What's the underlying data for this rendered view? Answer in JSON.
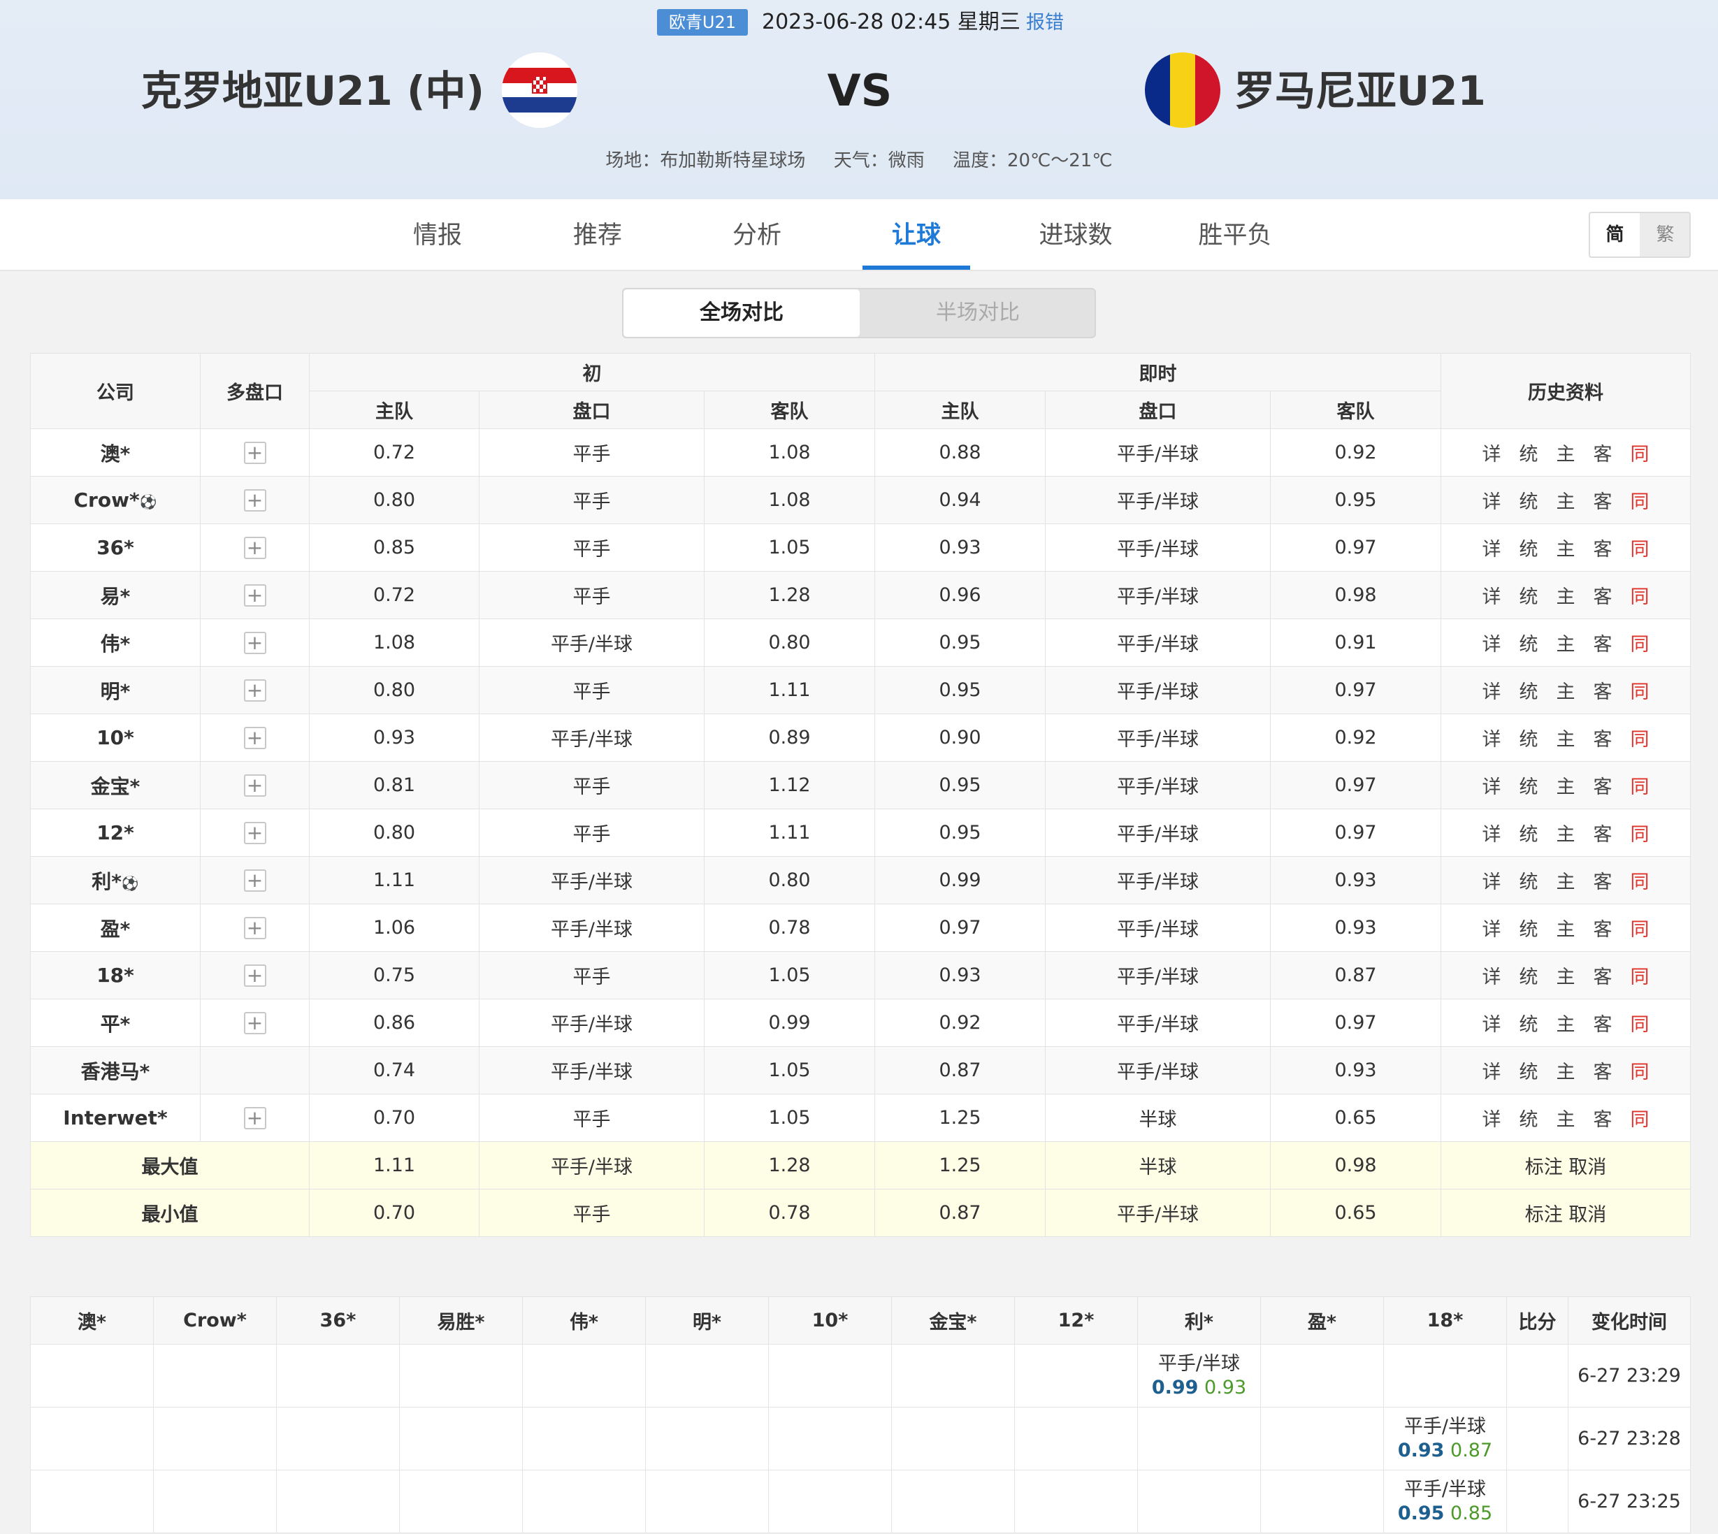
{
  "header": {
    "league": "欧青U21",
    "datetime": "2023-06-28 02:45 星期三",
    "report_label": "报错",
    "home_team": "克罗地亚U21 (中)",
    "away_team": "罗马尼亚U21",
    "vs": "VS",
    "venue": "场地：布加勒斯特星球场",
    "weather": "天气：微雨",
    "temperature": "温度：20℃～21℃",
    "home_flag": "croatia-flag-icon",
    "away_flag": "romania-flag-icon"
  },
  "tabs": [
    "情报",
    "推荐",
    "分析",
    "让球",
    "进球数",
    "胜平负"
  ],
  "active_tab": "让球",
  "lang": {
    "simple": "简",
    "trad": "繁"
  },
  "segment": {
    "full": "全场对比",
    "half": "半场对比"
  },
  "table": {
    "headers": {
      "company": "公司",
      "multi": "多盘口",
      "initial": "初",
      "live": "即时",
      "home": "主队",
      "line": "盘口",
      "away": "客队",
      "history": "历史资料"
    },
    "history_links": [
      "详",
      "统",
      "主",
      "客",
      "同"
    ],
    "rows": [
      {
        "company": "澳*",
        "ball": "",
        "plus": true,
        "i_home": "0.72",
        "i_line": "平手",
        "i_away": "1.08",
        "l_home": "0.88",
        "l_line": "平手/半球",
        "l_away": "0.92"
      },
      {
        "company": "Crow*",
        "ball": "⚽",
        "plus": true,
        "i_home": "0.80",
        "i_line": "平手",
        "i_away": "1.08",
        "l_home": "0.94",
        "l_line": "平手/半球",
        "l_away": "0.95"
      },
      {
        "company": "36*",
        "ball": "",
        "plus": true,
        "i_home": "0.85",
        "i_line": "平手",
        "i_away": "1.05",
        "l_home": "0.93",
        "l_line": "平手/半球",
        "l_away": "0.97"
      },
      {
        "company": "易*",
        "ball": "",
        "plus": true,
        "i_home": "0.72",
        "i_line": "平手",
        "i_away": "1.28",
        "l_home": "0.96",
        "l_line": "平手/半球",
        "l_away": "0.98"
      },
      {
        "company": "伟*",
        "ball": "",
        "plus": true,
        "i_home": "1.08",
        "i_line": "平手/半球",
        "i_away": "0.80",
        "l_home": "0.95",
        "l_line": "平手/半球",
        "l_away": "0.91"
      },
      {
        "company": "明*",
        "ball": "",
        "plus": true,
        "i_home": "0.80",
        "i_line": "平手",
        "i_away": "1.11",
        "l_home": "0.95",
        "l_line": "平手/半球",
        "l_away": "0.97"
      },
      {
        "company": "10*",
        "ball": "",
        "plus": true,
        "i_home": "0.93",
        "i_line": "平手/半球",
        "i_away": "0.89",
        "l_home": "0.90",
        "l_line": "平手/半球",
        "l_away": "0.92"
      },
      {
        "company": "金宝*",
        "ball": "",
        "plus": true,
        "i_home": "0.81",
        "i_line": "平手",
        "i_away": "1.12",
        "l_home": "0.95",
        "l_line": "平手/半球",
        "l_away": "0.97"
      },
      {
        "company": "12*",
        "ball": "",
        "plus": true,
        "i_home": "0.80",
        "i_line": "平手",
        "i_away": "1.11",
        "l_home": "0.95",
        "l_line": "平手/半球",
        "l_away": "0.97"
      },
      {
        "company": "利*",
        "ball": "⚽",
        "plus": true,
        "i_home": "1.11",
        "i_line": "平手/半球",
        "i_away": "0.80",
        "l_home": "0.99",
        "l_line": "平手/半球",
        "l_away": "0.93"
      },
      {
        "company": "盈*",
        "ball": "",
        "plus": true,
        "i_home": "1.06",
        "i_line": "平手/半球",
        "i_away": "0.78",
        "l_home": "0.97",
        "l_line": "平手/半球",
        "l_away": "0.93"
      },
      {
        "company": "18*",
        "ball": "",
        "plus": true,
        "i_home": "0.75",
        "i_line": "平手",
        "i_away": "1.05",
        "l_home": "0.93",
        "l_line": "平手/半球",
        "l_away": "0.87"
      },
      {
        "company": "平*",
        "ball": "",
        "plus": true,
        "i_home": "0.86",
        "i_line": "平手/半球",
        "i_away": "0.99",
        "l_home": "0.92",
        "l_line": "平手/半球",
        "l_away": "0.97"
      },
      {
        "company": "香港马*",
        "ball": "",
        "plus": false,
        "i_home": "0.74",
        "i_line": "平手/半球",
        "i_away": "1.05",
        "l_home": "0.87",
        "l_line": "平手/半球",
        "l_away": "0.93"
      },
      {
        "company": "Interwet*",
        "ball": "",
        "plus": true,
        "i_home": "0.70",
        "i_line": "平手",
        "i_away": "1.05",
        "l_home": "1.25",
        "l_line": "半球",
        "l_away": "0.65"
      }
    ],
    "max": {
      "label": "最大值",
      "i_home": "1.11",
      "i_line": "平手/半球",
      "i_away": "1.28",
      "l_home": "1.25",
      "l_line": "半球",
      "l_away": "0.98",
      "actions": "标注 取消"
    },
    "min": {
      "label": "最小值",
      "i_home": "0.70",
      "i_line": "平手",
      "i_away": "0.78",
      "l_home": "0.87",
      "l_line": "平手/半球",
      "l_away": "0.65",
      "actions": "标注 取消"
    }
  },
  "history": {
    "headers": [
      "澳*",
      "Crow*",
      "36*",
      "易胜*",
      "伟*",
      "明*",
      "10*",
      "金宝*",
      "12*",
      "利*",
      "盈*",
      "18*",
      "比分",
      "变化时间"
    ],
    "rows": [
      {
        "col": 9,
        "line": "平手/半球",
        "home": "0.99",
        "away": "0.93",
        "score": "",
        "time": "6-27 23:29"
      },
      {
        "col": 11,
        "line": "平手/半球",
        "home": "0.93",
        "away": "0.87",
        "score": "",
        "time": "6-27 23:28"
      },
      {
        "col": 11,
        "line": "平手/半球",
        "home": "0.95",
        "away": "0.85",
        "score": "",
        "time": "6-27 23:25"
      }
    ]
  }
}
